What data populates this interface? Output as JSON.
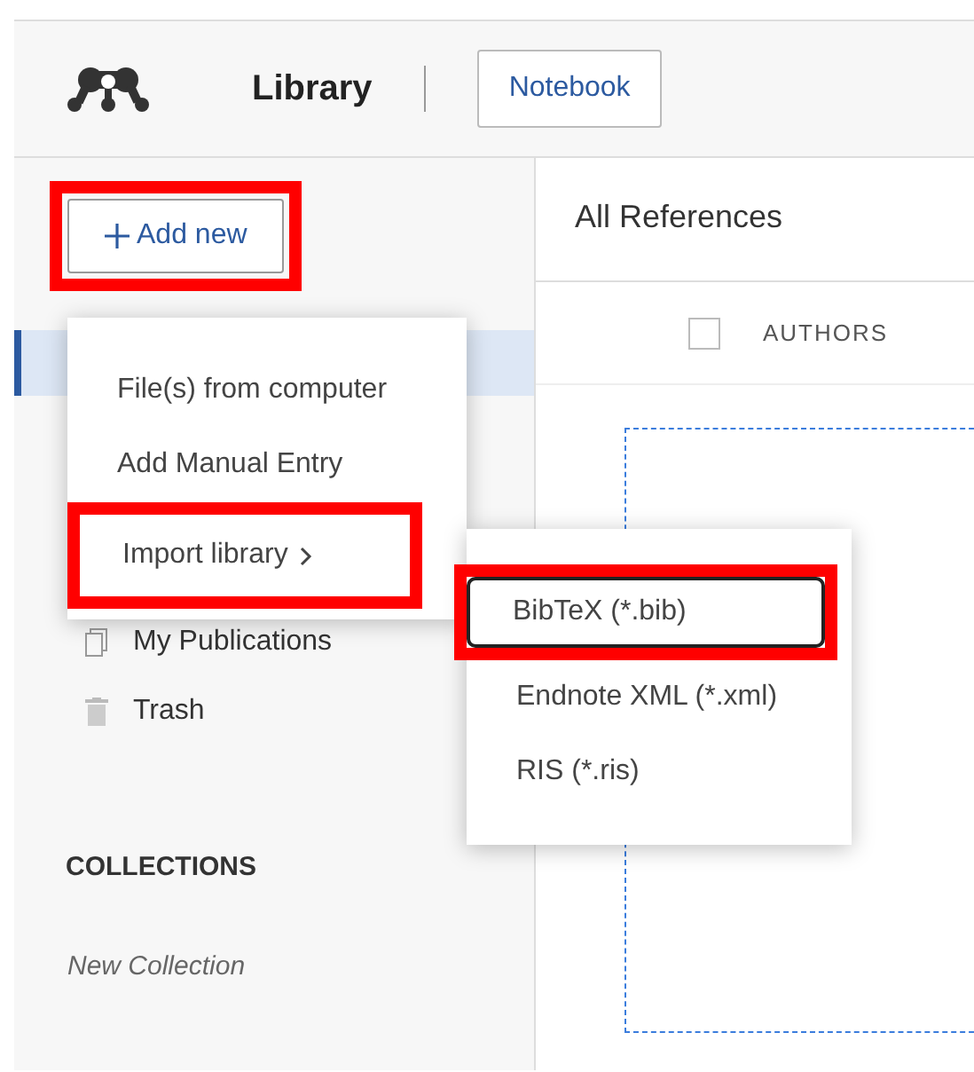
{
  "header": {
    "title": "Library",
    "tabs": [
      {
        "label": "Notebook",
        "selected": false
      }
    ]
  },
  "sidebar": {
    "add_button": {
      "label": "Add new",
      "highlighted": true
    },
    "items": [
      {
        "selected": true
      },
      {
        "label": "My Publications",
        "kind": "publications",
        "selected": false
      },
      {
        "label": "Trash",
        "kind": "trash",
        "selected": false
      }
    ],
    "collections_heading": "COLLECTIONS",
    "new_collection": "New Collection"
  },
  "main": {
    "title": "All References",
    "columns": [
      {
        "label": "AUTHORS",
        "checked": false
      }
    ]
  },
  "add_menu": {
    "items": [
      {
        "label": "File(s) from computer",
        "highlighted": false
      },
      {
        "label": "Add Manual Entry",
        "highlighted": false
      },
      {
        "label": "Import library",
        "submenu": true,
        "highlighted": true
      }
    ]
  },
  "import_menu": {
    "items": [
      {
        "label": "BibTeX (*.bib)",
        "focused": true,
        "highlighted": true
      },
      {
        "label": "Endnote XML (*.xml)",
        "focused": false,
        "highlighted": false
      },
      {
        "label": "RIS (*.ris)",
        "focused": false,
        "highlighted": false
      }
    ]
  }
}
